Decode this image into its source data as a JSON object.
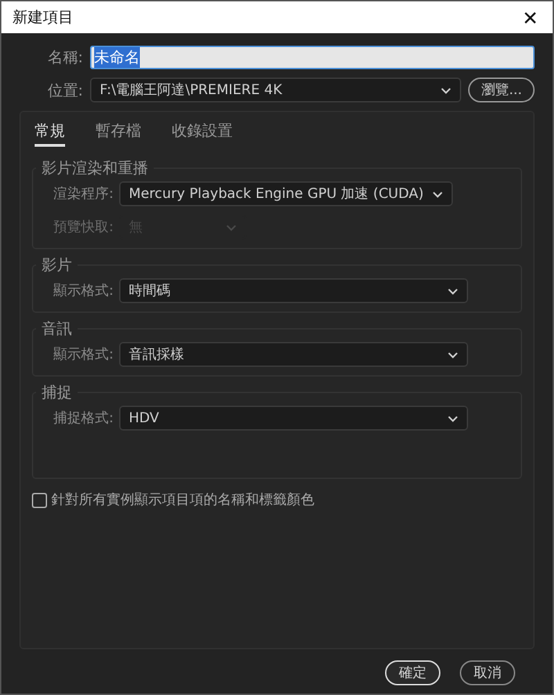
{
  "window": {
    "title": "新建項目",
    "close": "✕"
  },
  "name_field": {
    "label": "名稱:",
    "value": "未命名",
    "selected": true
  },
  "location": {
    "label": "位置:",
    "value": "F:\\電腦王阿達\\PREMIERE 4K"
  },
  "browse_button": "瀏覽...",
  "tabs": [
    {
      "label": "常規",
      "selected": true
    },
    {
      "label": "暫存檔",
      "selected": false
    },
    {
      "label": "收錄設置",
      "selected": false
    }
  ],
  "groups": [
    {
      "title": "影片渲染和重播",
      "tall": false,
      "rows": [
        {
          "label": "渲染程序:",
          "value": "Mercury Playback Engine GPU 加速 (CUDA)",
          "disabled": false,
          "wide": false
        },
        {
          "label": "預覽快取:",
          "value": "無",
          "disabled": true,
          "wide": false
        }
      ]
    },
    {
      "title": "影片",
      "tall": false,
      "rows": [
        {
          "label": "顯示格式:",
          "value": "時間碼",
          "disabled": false,
          "wide": true
        }
      ]
    },
    {
      "title": "音訊",
      "tall": false,
      "rows": [
        {
          "label": "顯示格式:",
          "value": "音訊採樣",
          "disabled": false,
          "wide": true
        }
      ]
    },
    {
      "title": "捕捉",
      "tall": true,
      "rows": [
        {
          "label": "捕捉格式:",
          "value": "HDV",
          "disabled": false,
          "wide": true
        }
      ]
    }
  ],
  "checkbox": {
    "label": "針對所有實例顯示項目項的名稱和標籤顏色",
    "checked": false
  },
  "buttons": [
    {
      "label": "確定",
      "default": true
    },
    {
      "label": "取消",
      "default": false
    }
  ]
}
